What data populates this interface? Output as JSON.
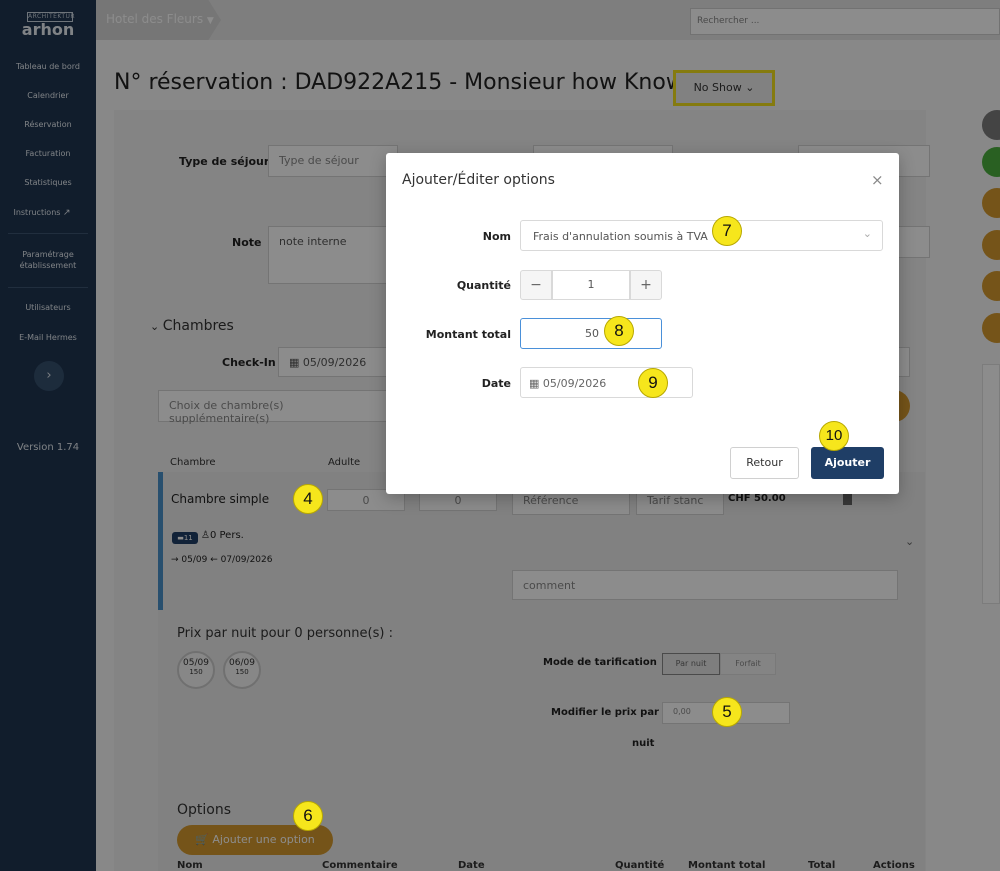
{
  "sidebar": {
    "logo_top": "ARCHITEKTUR",
    "logo_text": "arhon",
    "nav": [
      "Tableau de bord",
      "Calendrier",
      "Réservation",
      "Facturation",
      "Statistiques",
      "Instructions",
      "Paramétrage établissement",
      "Utilisateurs",
      "E-Mail Hermes"
    ],
    "version": "Version 1.74"
  },
  "topbar": {
    "hotel": "Hotel des Fleurs",
    "search_placeholder": "Rechercher ..."
  },
  "page": {
    "title": "N° réservation : DAD922A215 - Monsieur how Know",
    "status": "No Show",
    "type_sejour_label": "Type de séjour",
    "type_sejour_placeholder": "Type de séjour",
    "note_label": "Note",
    "note_value": "note interne",
    "chambres": "Chambres",
    "checkin_label": "Check-In",
    "checkin_value": "05/09/2026",
    "choix_placeholder": "Choix de chambre(s) supplémentaire(s)",
    "col_chambre": "Chambre",
    "col_adulte": "Adulte",
    "room_name": "Chambre simple",
    "adults": "0",
    "children": "0",
    "reference_placeholder": "Référence",
    "tarif": "Tarif stanc",
    "price": "CHF 50.00",
    "room_badge": "11",
    "persons": "0 Pers.",
    "dates": "→ 05/09 ← 07/09/2026",
    "comment_placeholder": "comment",
    "prix_nuit": "Prix par nuit pour 0 personne(s) :",
    "night1_date": "05/09",
    "night1_price": "150",
    "night2_date": "06/09",
    "night2_price": "150",
    "mode_label": "Mode de tarification",
    "mode_nuit": "Par nuit",
    "mode_forfait": "Forfait",
    "modifier_label": "Modifier le prix par",
    "modifier_label2": "nuit",
    "modifier_value": "0,00",
    "options_title": "Options",
    "add_option": "Ajouter une option",
    "options_cols": [
      "Nom",
      "Commentaire",
      "Date",
      "Quantité",
      "Montant total",
      "Total",
      "Actions"
    ]
  },
  "modal": {
    "title": "Ajouter/Éditer options",
    "nom_label": "Nom",
    "nom_value": "Frais d'annulation soumis à TVA",
    "qte_label": "Quantité",
    "qte_value": "1",
    "montant_label": "Montant total",
    "montant_value": "50",
    "date_label": "Date",
    "date_value": "05/09/2026",
    "retour": "Retour",
    "ajouter": "Ajouter"
  },
  "callouts": [
    "4",
    "5",
    "6",
    "7",
    "8",
    "9",
    "10"
  ],
  "colors": {
    "sidebar": "#1f3550",
    "primary": "#1f3e66",
    "orange": "#d69a2e",
    "highlight": "#f3e01c"
  }
}
